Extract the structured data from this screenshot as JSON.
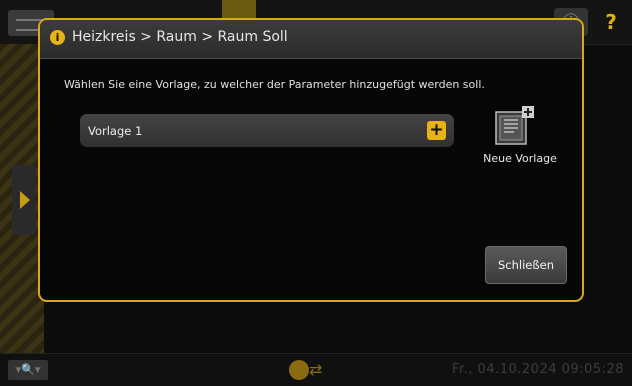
{
  "colors": {
    "accent": "#d7a91c",
    "dialog_bg": "#070707",
    "header_bg": "#333333"
  },
  "top_bar": {
    "help_icon": "?"
  },
  "dialog": {
    "title": "Heizkreis > Raum > Raum Soll",
    "instruction": "Wählen Sie eine Vorlage, zu welcher der Parameter hinzugefügt werden soll.",
    "templates": [
      {
        "label": "Vorlage 1",
        "action_icon": "plus-icon"
      }
    ],
    "new_template": {
      "label": "Neue Vorlage",
      "icon": "new-template-icon"
    },
    "close_label": "Schließen"
  },
  "status_bar": {
    "datetime": "Fr., 04.10.2024 09:05:28"
  }
}
